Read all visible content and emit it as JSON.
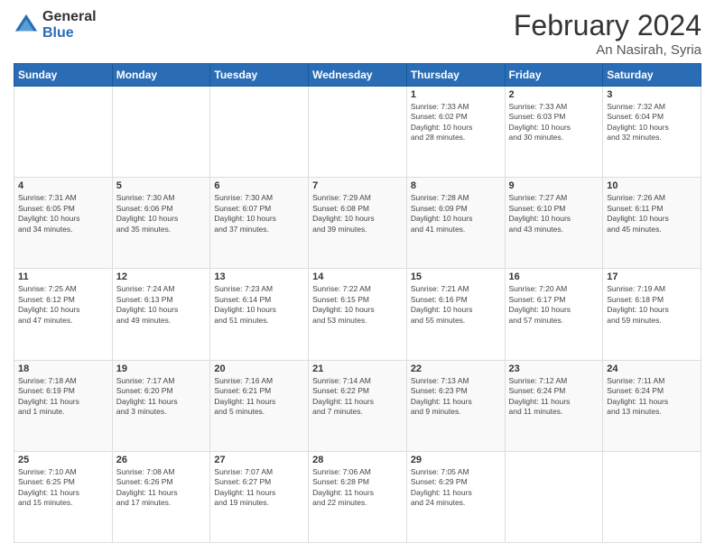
{
  "header": {
    "logo_general": "General",
    "logo_blue": "Blue",
    "month_title": "February 2024",
    "location": "An Nasirah, Syria"
  },
  "days_of_week": [
    "Sunday",
    "Monday",
    "Tuesday",
    "Wednesday",
    "Thursday",
    "Friday",
    "Saturday"
  ],
  "weeks": [
    [
      {
        "day": "",
        "info": ""
      },
      {
        "day": "",
        "info": ""
      },
      {
        "day": "",
        "info": ""
      },
      {
        "day": "",
        "info": ""
      },
      {
        "day": "1",
        "info": "Sunrise: 7:33 AM\nSunset: 6:02 PM\nDaylight: 10 hours\nand 28 minutes."
      },
      {
        "day": "2",
        "info": "Sunrise: 7:33 AM\nSunset: 6:03 PM\nDaylight: 10 hours\nand 30 minutes."
      },
      {
        "day": "3",
        "info": "Sunrise: 7:32 AM\nSunset: 6:04 PM\nDaylight: 10 hours\nand 32 minutes."
      }
    ],
    [
      {
        "day": "4",
        "info": "Sunrise: 7:31 AM\nSunset: 6:05 PM\nDaylight: 10 hours\nand 34 minutes."
      },
      {
        "day": "5",
        "info": "Sunrise: 7:30 AM\nSunset: 6:06 PM\nDaylight: 10 hours\nand 35 minutes."
      },
      {
        "day": "6",
        "info": "Sunrise: 7:30 AM\nSunset: 6:07 PM\nDaylight: 10 hours\nand 37 minutes."
      },
      {
        "day": "7",
        "info": "Sunrise: 7:29 AM\nSunset: 6:08 PM\nDaylight: 10 hours\nand 39 minutes."
      },
      {
        "day": "8",
        "info": "Sunrise: 7:28 AM\nSunset: 6:09 PM\nDaylight: 10 hours\nand 41 minutes."
      },
      {
        "day": "9",
        "info": "Sunrise: 7:27 AM\nSunset: 6:10 PM\nDaylight: 10 hours\nand 43 minutes."
      },
      {
        "day": "10",
        "info": "Sunrise: 7:26 AM\nSunset: 6:11 PM\nDaylight: 10 hours\nand 45 minutes."
      }
    ],
    [
      {
        "day": "11",
        "info": "Sunrise: 7:25 AM\nSunset: 6:12 PM\nDaylight: 10 hours\nand 47 minutes."
      },
      {
        "day": "12",
        "info": "Sunrise: 7:24 AM\nSunset: 6:13 PM\nDaylight: 10 hours\nand 49 minutes."
      },
      {
        "day": "13",
        "info": "Sunrise: 7:23 AM\nSunset: 6:14 PM\nDaylight: 10 hours\nand 51 minutes."
      },
      {
        "day": "14",
        "info": "Sunrise: 7:22 AM\nSunset: 6:15 PM\nDaylight: 10 hours\nand 53 minutes."
      },
      {
        "day": "15",
        "info": "Sunrise: 7:21 AM\nSunset: 6:16 PM\nDaylight: 10 hours\nand 55 minutes."
      },
      {
        "day": "16",
        "info": "Sunrise: 7:20 AM\nSunset: 6:17 PM\nDaylight: 10 hours\nand 57 minutes."
      },
      {
        "day": "17",
        "info": "Sunrise: 7:19 AM\nSunset: 6:18 PM\nDaylight: 10 hours\nand 59 minutes."
      }
    ],
    [
      {
        "day": "18",
        "info": "Sunrise: 7:18 AM\nSunset: 6:19 PM\nDaylight: 11 hours\nand 1 minute."
      },
      {
        "day": "19",
        "info": "Sunrise: 7:17 AM\nSunset: 6:20 PM\nDaylight: 11 hours\nand 3 minutes."
      },
      {
        "day": "20",
        "info": "Sunrise: 7:16 AM\nSunset: 6:21 PM\nDaylight: 11 hours\nand 5 minutes."
      },
      {
        "day": "21",
        "info": "Sunrise: 7:14 AM\nSunset: 6:22 PM\nDaylight: 11 hours\nand 7 minutes."
      },
      {
        "day": "22",
        "info": "Sunrise: 7:13 AM\nSunset: 6:23 PM\nDaylight: 11 hours\nand 9 minutes."
      },
      {
        "day": "23",
        "info": "Sunrise: 7:12 AM\nSunset: 6:24 PM\nDaylight: 11 hours\nand 11 minutes."
      },
      {
        "day": "24",
        "info": "Sunrise: 7:11 AM\nSunset: 6:24 PM\nDaylight: 11 hours\nand 13 minutes."
      }
    ],
    [
      {
        "day": "25",
        "info": "Sunrise: 7:10 AM\nSunset: 6:25 PM\nDaylight: 11 hours\nand 15 minutes."
      },
      {
        "day": "26",
        "info": "Sunrise: 7:08 AM\nSunset: 6:26 PM\nDaylight: 11 hours\nand 17 minutes."
      },
      {
        "day": "27",
        "info": "Sunrise: 7:07 AM\nSunset: 6:27 PM\nDaylight: 11 hours\nand 19 minutes."
      },
      {
        "day": "28",
        "info": "Sunrise: 7:06 AM\nSunset: 6:28 PM\nDaylight: 11 hours\nand 22 minutes."
      },
      {
        "day": "29",
        "info": "Sunrise: 7:05 AM\nSunset: 6:29 PM\nDaylight: 11 hours\nand 24 minutes."
      },
      {
        "day": "",
        "info": ""
      },
      {
        "day": "",
        "info": ""
      }
    ]
  ]
}
